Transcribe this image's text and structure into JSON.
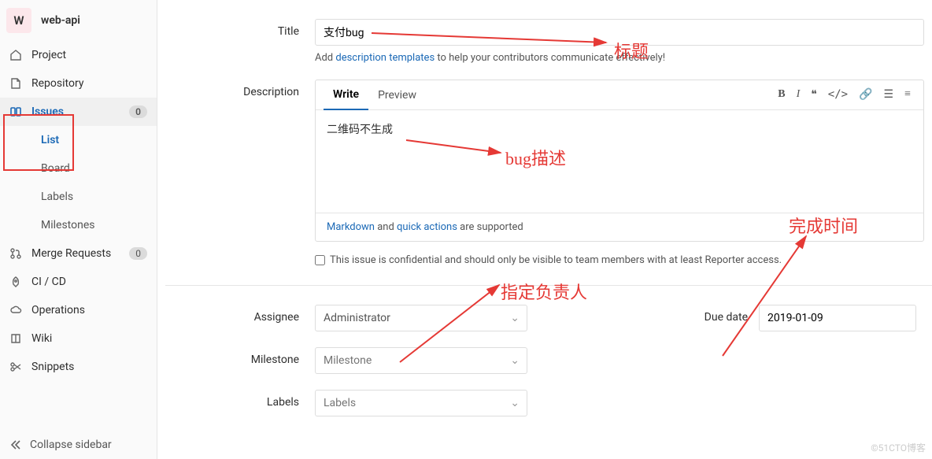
{
  "sidebar": {
    "project_avatar_letter": "W",
    "project_name": "web-api",
    "items": {
      "project": {
        "label": "Project"
      },
      "repository": {
        "label": "Repository"
      },
      "issues": {
        "label": "Issues",
        "badge": "0"
      },
      "merge_requests": {
        "label": "Merge Requests",
        "badge": "0"
      },
      "cicd": {
        "label": "CI / CD"
      },
      "operations": {
        "label": "Operations"
      },
      "wiki": {
        "label": "Wiki"
      },
      "snippets": {
        "label": "Snippets"
      }
    },
    "issues_sub": {
      "list": "List",
      "board": "Board",
      "labels": "Labels",
      "milestones": "Milestones"
    },
    "collapse": "Collapse sidebar"
  },
  "form": {
    "title_label": "Title",
    "title_value": "支付bug",
    "title_help_prefix": "Add ",
    "title_help_link": "description templates",
    "title_help_suffix": " to help your contributors communicate effectively!",
    "description_label": "Description",
    "tabs": {
      "write": "Write",
      "preview": "Preview"
    },
    "description_value": "二维码不生成",
    "footer_markdown": "Markdown",
    "footer_mid": " and ",
    "footer_quick": "quick actions",
    "footer_suffix": " are supported",
    "confidential_text": "This issue is confidential and should only be visible to team members with at least Reporter access.",
    "assignee_label": "Assignee",
    "assignee_value": "Administrator",
    "milestone_label": "Milestone",
    "milestone_placeholder": "Milestone",
    "labels_label": "Labels",
    "labels_placeholder": "Labels",
    "due_date_label": "Due date",
    "due_date_value": "2019-01-09"
  },
  "annotations": {
    "title": "标题",
    "desc": "bug描述",
    "assignee": "指定负责人",
    "due": "完成时间"
  },
  "watermark": "©51CTO博客"
}
